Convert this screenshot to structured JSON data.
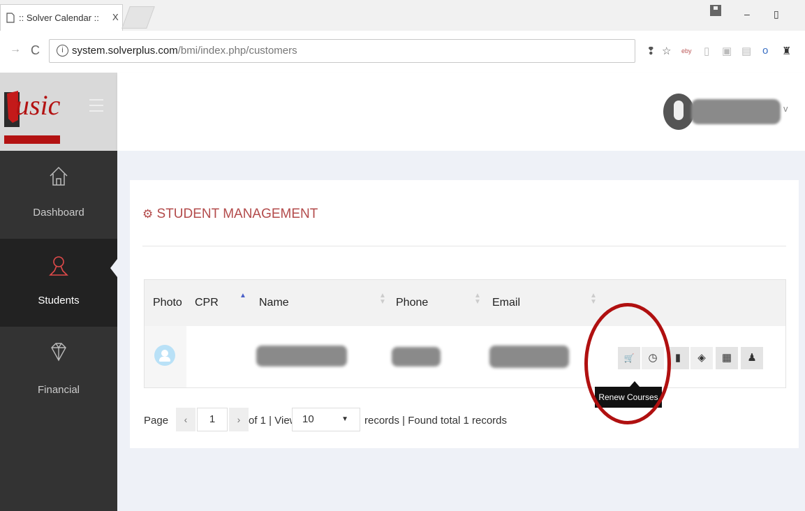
{
  "browser": {
    "tab_title": ":: Solver Calendar ::",
    "tab_close": "X",
    "url_host": "system.solverplus.com",
    "url_path": "/bmi/index.php/customers",
    "nav_forward": "→",
    "nav_reload": "C",
    "window_min": "–",
    "window_max": "▯"
  },
  "sidebar": {
    "items": [
      {
        "label": "Dashboard",
        "icon": "home-icon",
        "active": false
      },
      {
        "label": "Students",
        "icon": "students-icon",
        "active": true
      },
      {
        "label": "Financial",
        "icon": "diamond-icon",
        "active": false
      }
    ]
  },
  "page": {
    "title": "STUDENT MANAGEMENT"
  },
  "table": {
    "columns": [
      "Photo",
      "CPR",
      "Name",
      "Phone",
      "Email"
    ],
    "actions": [
      "cart-icon",
      "clock-icon",
      "book-icon",
      "diamond-icon",
      "calendar-icon",
      "user-icon"
    ],
    "action_glyphs": [
      "🛒",
      "◷",
      "▮",
      "◈",
      "▦",
      "♟"
    ],
    "tooltip": "Renew Courses"
  },
  "pager": {
    "page_label": "Page",
    "prev": "‹",
    "current": "1",
    "next": "›",
    "of_text": "of 1 | View",
    "view_value": "10",
    "records_text": "records | Found total 1 records"
  },
  "colors": {
    "accent": "#b34b4b",
    "sidebar": "#333333",
    "circle": "#b01010"
  }
}
